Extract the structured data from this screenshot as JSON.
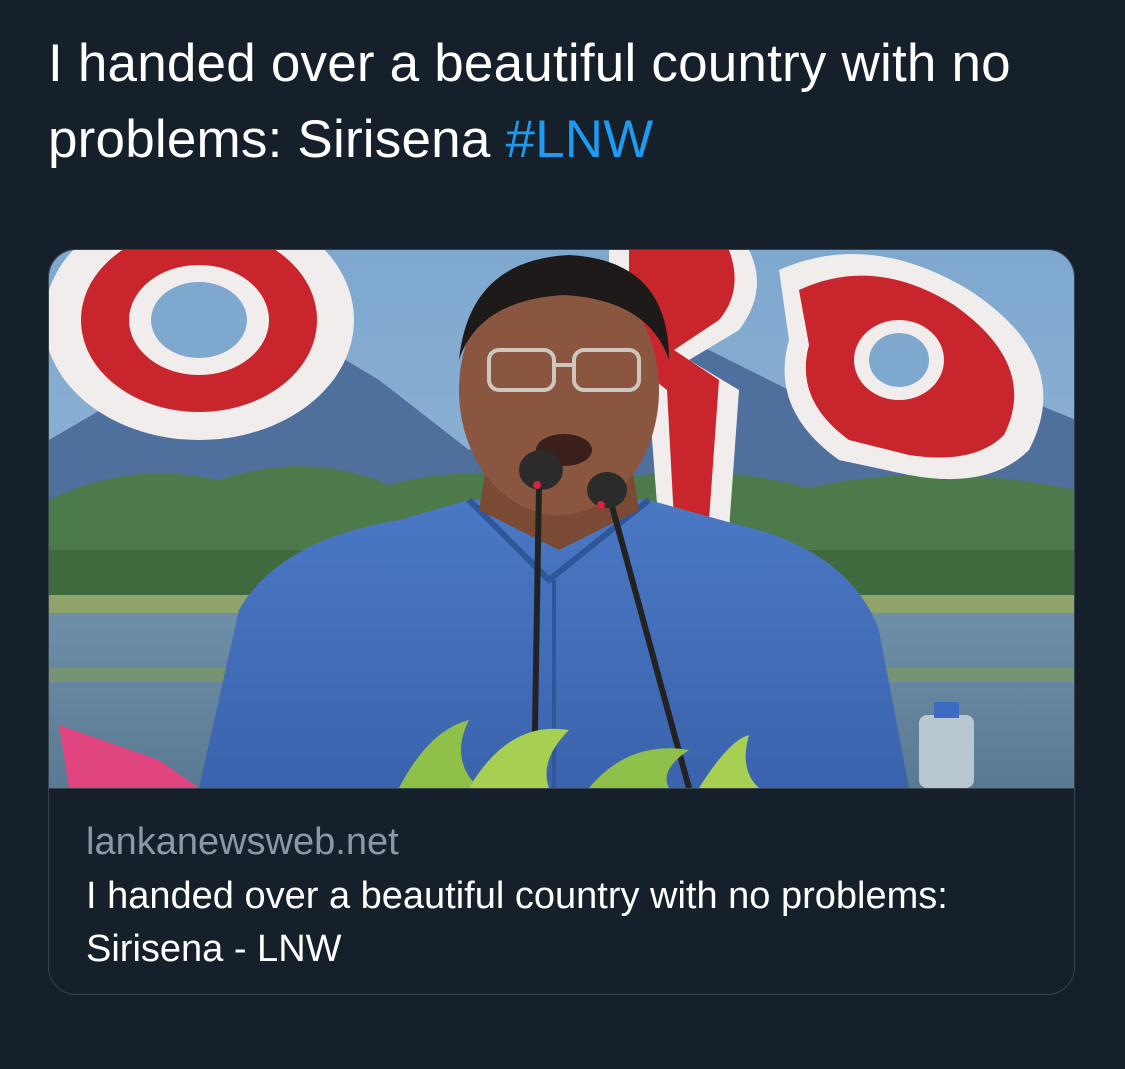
{
  "tweet": {
    "text": "I handed over a beautiful country with no problems: Sirisena",
    "hashtag": "#LNW"
  },
  "card": {
    "image_icon": "photo-speaker-at-podium",
    "domain": "lankanewsweb.net",
    "title": "I handed over a beautiful country with no problems: Sirisena - LNW"
  },
  "colors": {
    "background": "#15202b",
    "text": "#ffffff",
    "link": "#1d9bf0",
    "muted": "#8b98a5",
    "border": "#38444d"
  }
}
